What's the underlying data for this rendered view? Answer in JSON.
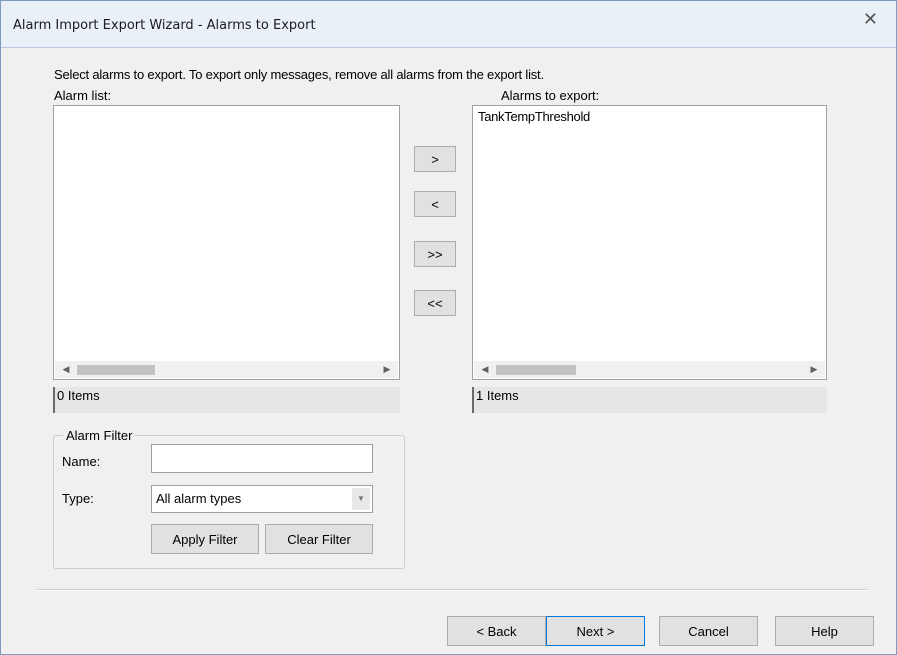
{
  "window": {
    "title": "Alarm Import Export Wizard - Alarms to Export",
    "close_glyph": "✕"
  },
  "instructions": "Select alarms to export.  To export only messages, remove all alarms from the export list.",
  "alarm_list": {
    "label": "Alarm list:",
    "items": [],
    "count": "0 Items"
  },
  "export_list": {
    "label": "Alarms to export:",
    "items": [
      "TankTempThreshold"
    ],
    "count": "1 Items"
  },
  "move_buttons": {
    "add": ">",
    "remove": "<",
    "add_all": ">>",
    "remove_all": "<<"
  },
  "filter": {
    "title": "Alarm Filter",
    "name_label": "Name:",
    "name_value": "",
    "type_label": "Type:",
    "type_value": "All alarm types",
    "apply": "Apply Filter",
    "clear": "Clear Filter"
  },
  "nav": {
    "back": "< Back",
    "next": "Next >",
    "cancel": "Cancel",
    "help": "Help"
  },
  "icons": {
    "scroll_left": "scroll-left-icon",
    "scroll_right": "scroll-right-icon",
    "dropdown": "chevron-down-icon",
    "close": "close-icon"
  },
  "colors": {
    "accent": "#0078d7",
    "title_bg": "#eaf0f7"
  }
}
